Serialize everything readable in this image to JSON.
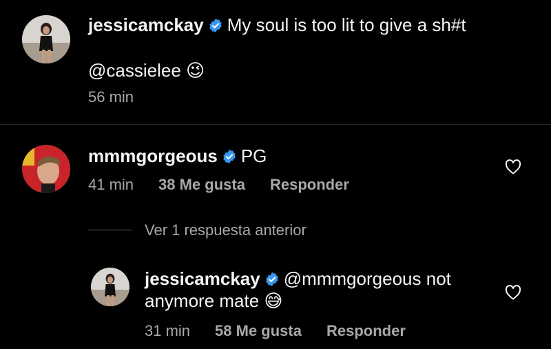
{
  "caption": {
    "username": "jessicamckay",
    "text": "My soul is too lit to give a sh#t",
    "mention": "@cassielee",
    "emoji": "😉",
    "time": "56 min"
  },
  "comment1": {
    "username": "mmmgorgeous",
    "text": "PG",
    "time": "41 min",
    "likes": "38 Me gusta",
    "reply_label": "Responder"
  },
  "view_replies": {
    "label": "Ver 1 respuesta anterior"
  },
  "reply1": {
    "username": "jessicamckay",
    "text_line1": "@mmmgorgeous not",
    "text_line2": "anymore mate",
    "emoji": "😅",
    "time": "31 min",
    "likes": "58 Me gusta",
    "reply_label": "Responder"
  },
  "colors": {
    "background": "#000000",
    "text": "#f5f5f5",
    "secondary": "#a8a8a8",
    "verified": "#3897f0"
  },
  "icons": {
    "verified": "verified-badge-icon",
    "like": "heart-outline-icon"
  }
}
